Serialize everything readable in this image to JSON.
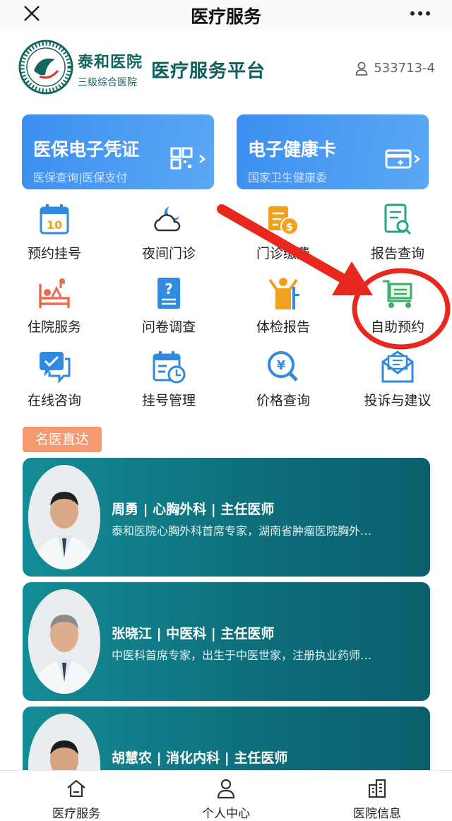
{
  "topbar": {
    "title": "医疗服务",
    "close_icon": "close-icon",
    "more_icon": "more-icon"
  },
  "header": {
    "logo": {
      "name": "泰和医院",
      "subtitle": "三级综合医院",
      "seal_text": "CHANGSHA TAIHE HOSPITAL"
    },
    "platform_title": "医疗服务平台",
    "user_id": "533713-4"
  },
  "banners": [
    {
      "title": "医保电子凭证",
      "subtitle": "医保查询|医保支付",
      "icon": "qr-code-icon"
    },
    {
      "title": "电子健康卡",
      "subtitle": "国家卫生健康委",
      "icon": "health-card-icon"
    }
  ],
  "services": [
    {
      "label": "预约挂号",
      "icon": "calendar-icon",
      "color": "#2f8ae0"
    },
    {
      "label": "夜间门诊",
      "icon": "night-cloud-icon",
      "color": "#2f8ae0"
    },
    {
      "label": "门诊缴费",
      "icon": "payment-icon",
      "color": "#f0a21e"
    },
    {
      "label": "报告查询",
      "icon": "report-search-icon",
      "color": "#27a383"
    },
    {
      "label": "住院服务",
      "icon": "hospital-bed-icon",
      "color": "#ea6b4e"
    },
    {
      "label": "问卷调查",
      "icon": "questionnaire-icon",
      "color": "#2f8ae0"
    },
    {
      "label": "体检报告",
      "icon": "checkup-icon",
      "color": "#f0a21e"
    },
    {
      "label": "自助预约",
      "icon": "cart-icon",
      "color": "#3fae6c"
    },
    {
      "label": "在线咨询",
      "icon": "chat-icon",
      "color": "#2f8ae0"
    },
    {
      "label": "挂号管理",
      "icon": "schedule-icon",
      "color": "#2f8ae0"
    },
    {
      "label": "价格查询",
      "icon": "price-search-icon",
      "color": "#2f8ae0"
    },
    {
      "label": "投诉与建议",
      "icon": "mail-icon",
      "color": "#2f8ae0"
    }
  ],
  "doctors": {
    "section_tag": "名医直达",
    "items": [
      {
        "name": "周勇 | 心胸外科 | 主任医师",
        "desc": "泰和医院心胸外科首席专家，湖南省肿瘤医院胸外…"
      },
      {
        "name": "张晓江 | 中医科 | 主任医师",
        "desc": "中医科首席专家，出生于中医世家，注册执业药师…"
      },
      {
        "name": "胡慧农 | 消化内科 | 主任医师",
        "desc": ""
      }
    ]
  },
  "tabbar": [
    {
      "label": "医疗服务",
      "icon": "home-icon"
    },
    {
      "label": "个人中心",
      "icon": "person-icon"
    },
    {
      "label": "医院信息",
      "icon": "building-icon"
    }
  ],
  "colors": {
    "accent": "#0e5f5c",
    "banner": "#4a9cf2",
    "doctor_card": "#11808b",
    "tag": "#f59a70",
    "annotation": "#e8281e"
  }
}
